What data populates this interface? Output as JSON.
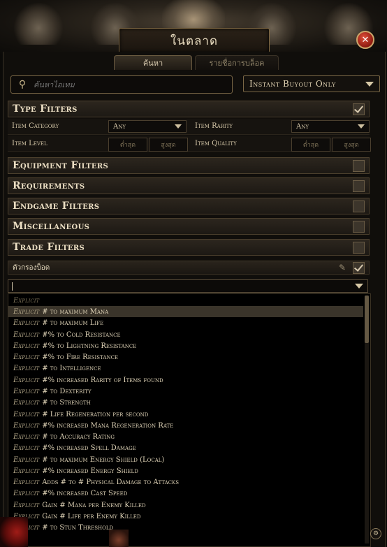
{
  "window": {
    "title": "ในตลาด",
    "close_icon": "close-icon"
  },
  "tabs": [
    {
      "label": "ค้นหา",
      "active": true
    },
    {
      "label": "รายชื่อการบล็อค",
      "active": false
    }
  ],
  "search": {
    "placeholder": "ค้นหาไอเทม",
    "value": ""
  },
  "buyout": {
    "selected": "Instant Buyout Only"
  },
  "type_filters": {
    "label": "Type Filters",
    "checked": true,
    "item_category_label": "Item Category",
    "item_category_value": "Any",
    "item_rarity_label": "Item Rarity",
    "item_rarity_value": "Any",
    "item_level_label": "Item Level",
    "item_level_min": "ต่ำสุด",
    "item_level_max": "สูงสุด",
    "item_quality_label": "Item Quality",
    "item_quality_min": "ต่ำสุด",
    "item_quality_max": "สูงสุด"
  },
  "filter_groups": [
    {
      "label": "Equipment Filters",
      "checked": false
    },
    {
      "label": "Requirements",
      "checked": false
    },
    {
      "label": "Endgame Filters",
      "checked": false
    },
    {
      "label": "Miscellaneous",
      "checked": false
    },
    {
      "label": "Trade Filters",
      "checked": false
    }
  ],
  "stat_filters": {
    "label": "ตัวกรองบ็อด",
    "checked": true,
    "input_value": ""
  },
  "dropdown": {
    "group_label": "Explicit",
    "items": [
      {
        "prefix": "Explicit",
        "text": "# to maximum Mana",
        "selected": true
      },
      {
        "prefix": "Explicit",
        "text": "# to maximum Life"
      },
      {
        "prefix": "Explicit",
        "text": "#% to Cold Resistance"
      },
      {
        "prefix": "Explicit",
        "text": "#% to Lightning Resistance"
      },
      {
        "prefix": "Explicit",
        "text": "#% to Fire Resistance"
      },
      {
        "prefix": "Explicit",
        "text": "# to Intelligence"
      },
      {
        "prefix": "Explicit",
        "text": "#% increased Rarity of Items found"
      },
      {
        "prefix": "Explicit",
        "text": "# to Dexterity"
      },
      {
        "prefix": "Explicit",
        "text": "# to Strength"
      },
      {
        "prefix": "Explicit",
        "text": "# Life Regeneration per second"
      },
      {
        "prefix": "Explicit",
        "text": "#% increased Mana Regeneration Rate"
      },
      {
        "prefix": "Explicit",
        "text": "# to Accuracy Rating"
      },
      {
        "prefix": "Explicit",
        "text": "#% increased Spell Damage"
      },
      {
        "prefix": "Explicit",
        "text": "# to maximum Energy Shield (Local)"
      },
      {
        "prefix": "Explicit",
        "text": "#% increased Energy Shield"
      },
      {
        "prefix": "Explicit",
        "text": "Adds # to # Physical Damage to Attacks"
      },
      {
        "prefix": "Explicit",
        "text": "#% increased Cast Speed"
      },
      {
        "prefix": "Explicit",
        "text": "Gain # Mana per Enemy Killed"
      },
      {
        "prefix": "Explicit",
        "text": "Gain # Life per Enemy Killed"
      },
      {
        "prefix": "Explicit",
        "text": "# to Stun Threshold"
      }
    ]
  }
}
